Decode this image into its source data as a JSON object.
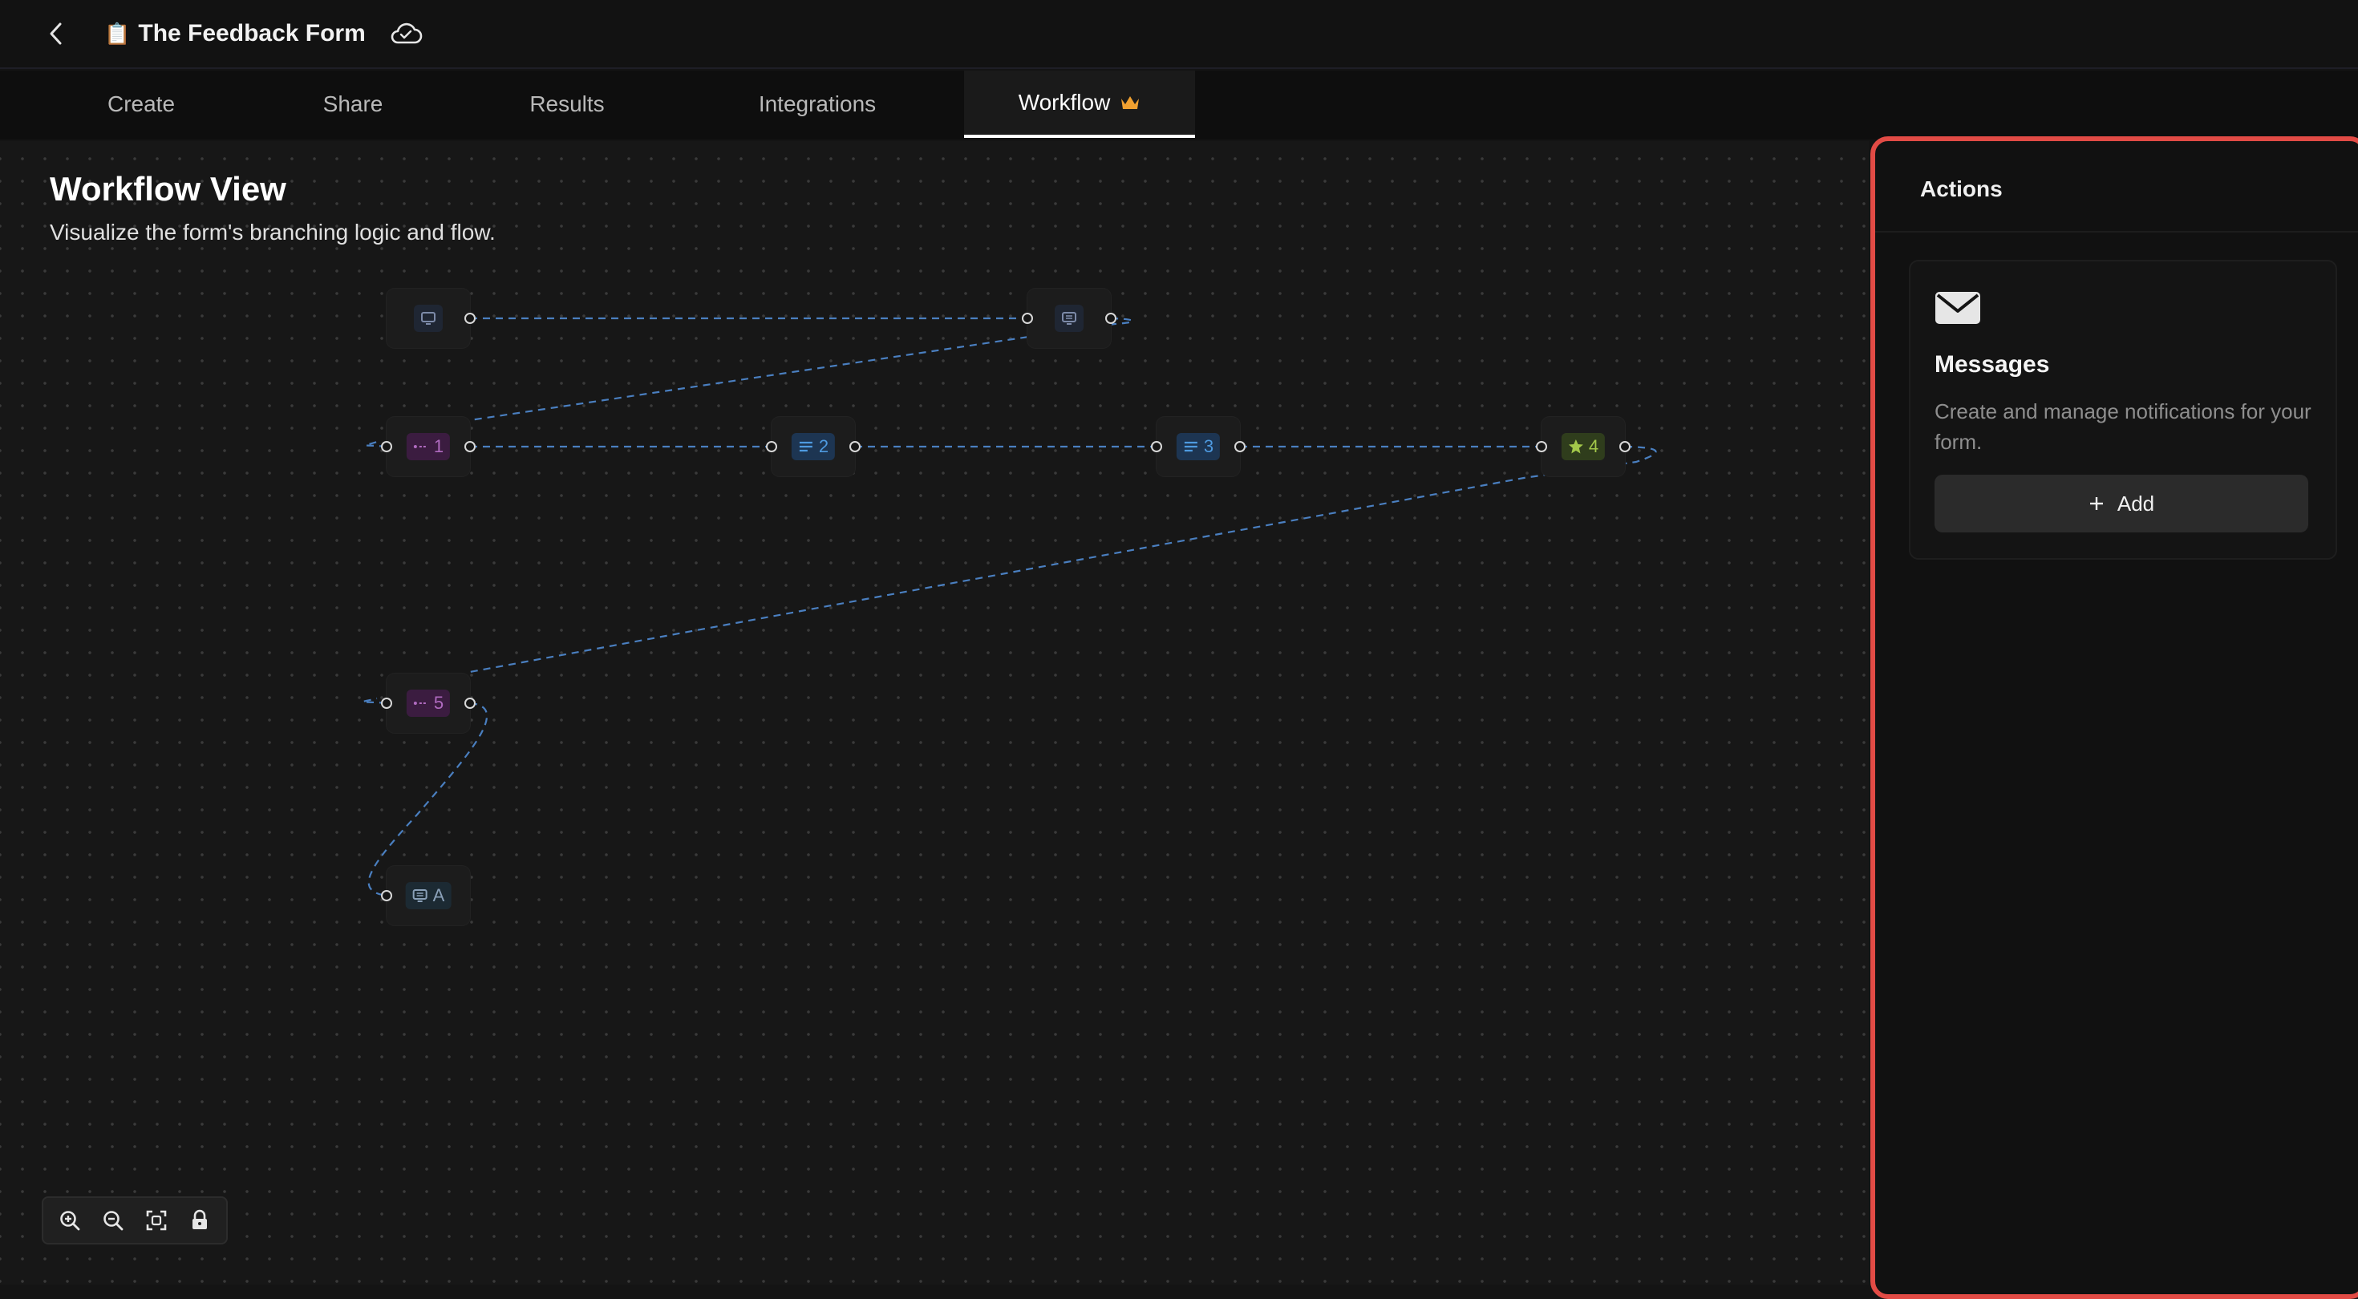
{
  "header": {
    "title": "The Feedback Form",
    "title_emoji": "📋",
    "back_icon": "chevron-left-icon",
    "cloud_icon": "cloud-icon"
  },
  "tabs": [
    {
      "label": "Create"
    },
    {
      "label": "Share"
    },
    {
      "label": "Results"
    },
    {
      "label": "Integrations"
    },
    {
      "label": "Workflow",
      "active": true,
      "badge_icon": "crown-icon"
    }
  ],
  "canvas": {
    "title": "Workflow View",
    "subtitle": "Visualize the form's branching logic and flow."
  },
  "nodes": [
    {
      "id": "welcome",
      "kind": "message",
      "label": ""
    },
    {
      "id": "message-2",
      "kind": "message",
      "label": ""
    },
    {
      "id": "q1",
      "kind": "list",
      "label": "1"
    },
    {
      "id": "q2",
      "kind": "text",
      "label": "2"
    },
    {
      "id": "q3",
      "kind": "text",
      "label": "3"
    },
    {
      "id": "q4",
      "kind": "rating",
      "label": "4"
    },
    {
      "id": "q5",
      "kind": "list",
      "label": "5"
    },
    {
      "id": "endA",
      "kind": "message",
      "label": "A"
    }
  ],
  "zoom_controls": [
    "zoom-in-icon",
    "zoom-out-icon",
    "fit-view-icon",
    "lock-icon"
  ],
  "actions_panel": {
    "title": "Actions",
    "card": {
      "icon": "envelope-icon",
      "title": "Messages",
      "description": "Create and manage notifications for your form.",
      "add_label": "Add"
    }
  },
  "colors": {
    "accent_border": "#e24b45",
    "crown": "#f0a030",
    "edge": "#4a7fc0"
  }
}
